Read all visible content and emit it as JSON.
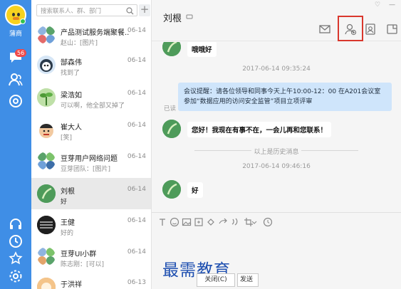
{
  "user": {
    "name": "蒲商"
  },
  "nav": {
    "messages_badge": "56"
  },
  "search": {
    "placeholder": "搜索联系人、群、部门",
    "add_label": "+"
  },
  "conversations": [
    {
      "name": "产品测试服务端聚餐...",
      "preview": "赵山：[图片]",
      "date": "06-14"
    },
    {
      "name": "郜森伟",
      "preview": "找到了",
      "date": "06-14"
    },
    {
      "name": "梁浩如",
      "preview": "可以啊，他全部又掉了",
      "date": "06-14"
    },
    {
      "name": "崔大人",
      "preview": "[笑]",
      "date": "06-14"
    },
    {
      "name": "豆芽用户网络问题",
      "preview": "豆芽团队：[图片]",
      "date": "06-14"
    },
    {
      "name": "刘根",
      "preview": "好",
      "date": "06-14"
    },
    {
      "name": "王健",
      "preview": "好的",
      "date": "06-14"
    },
    {
      "name": "豆芽UI小群",
      "preview": "陈志刚：[可以]",
      "date": "06-14"
    },
    {
      "name": "于洪祥",
      "preview": "",
      "date": "06-13"
    }
  ],
  "chat": {
    "title": "刘根",
    "msg1": "哦哦好",
    "ts1": "2017-06-14 09:35:24",
    "my_msg": "会议提醒：请各位领导和同事今天上午10:00-12：00 在A201会议室参加“数据应用的访问安全监管”项目立项评审",
    "read_flag": "已读",
    "msg2": "您好！我现在有事不在，一会儿再和您联系！",
    "history_sep": "以上是历史消息",
    "ts2": "2017-06-14 09:46:16",
    "msg3": "好"
  },
  "footer": {
    "watermark": "最需教育",
    "close_label": "关闭(C)",
    "send_label": "发送"
  },
  "colors": {
    "rail": "#3f8ee6",
    "my_bubble": "#cfe5fb",
    "highlight_box": "#d9372d",
    "badge": "#f04a4a"
  }
}
